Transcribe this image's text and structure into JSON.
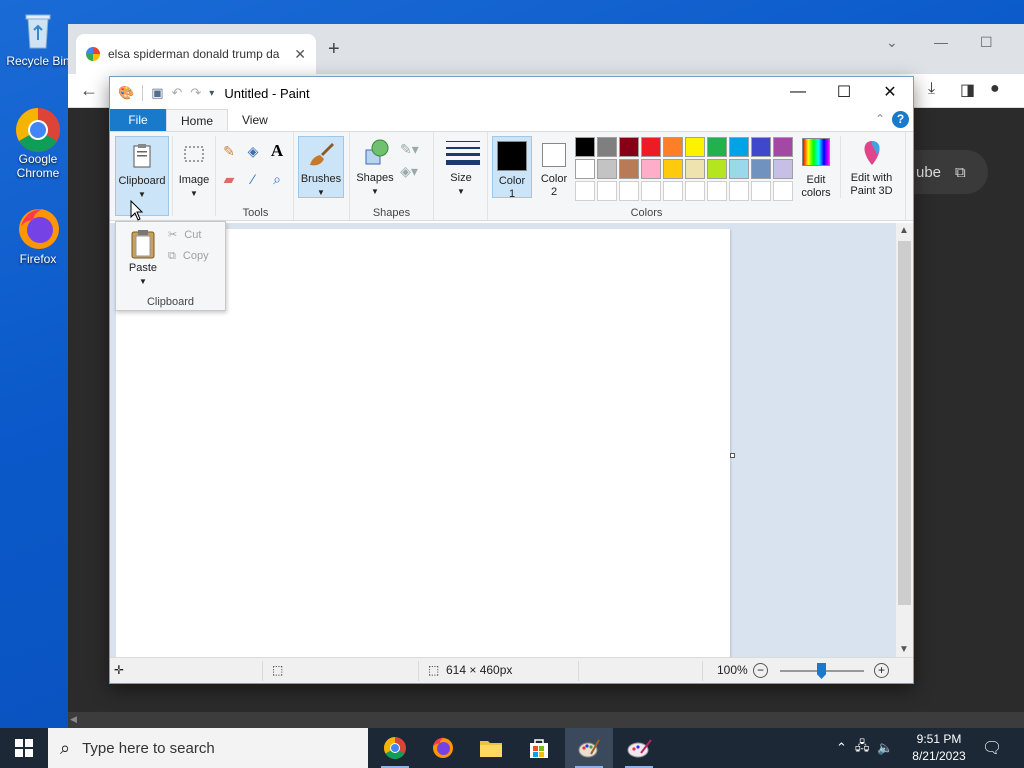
{
  "desktop": {
    "icons": [
      {
        "label": "Recycle Bin"
      },
      {
        "label": "Google Chrome"
      },
      {
        "label": "Firefox"
      }
    ]
  },
  "chrome": {
    "tab_title": "elsa spiderman donald trump da",
    "youtube_button_text": "ube"
  },
  "paint": {
    "title": "Untitled - Paint",
    "tabs": {
      "file": "File",
      "home": "Home",
      "view": "View"
    },
    "ribbon": {
      "clipboard": "Clipboard",
      "image": "Image",
      "tools_group": "Tools",
      "brushes": "Brushes",
      "shapes": "Shapes",
      "shapes_group": "Shapes",
      "size": "Size",
      "color1": "Color\n1",
      "color2": "Color\n2",
      "colors_group": "Colors",
      "edit_colors": "Edit\ncolors",
      "edit_paint3d": "Edit with\nPaint 3D"
    },
    "palette_colors": [
      "#000000",
      "#7f7f7f",
      "#880015",
      "#ed1c24",
      "#ff7f27",
      "#fff200",
      "#22b14c",
      "#00a2e8",
      "#3f48cc",
      "#a349a4",
      "#ffffff",
      "#c3c3c3",
      "#b97a57",
      "#ffaec9",
      "#ffc90e",
      "#efe4b0",
      "#b5e61d",
      "#99d9ea",
      "#7092be",
      "#c8bfe7",
      "#ffffff",
      "#ffffff",
      "#ffffff",
      "#ffffff",
      "#ffffff",
      "#ffffff",
      "#ffffff",
      "#ffffff",
      "#ffffff",
      "#ffffff"
    ],
    "color1_value": "#000000",
    "color2_value": "#ffffff",
    "clipboard_dropdown": {
      "paste": "Paste",
      "cut": "Cut",
      "copy": "Copy",
      "group": "Clipboard"
    },
    "status": {
      "image_size": "614 × 460px",
      "zoom": "100%"
    }
  },
  "taskbar": {
    "search_placeholder": "Type here to search",
    "time": "9:51 PM",
    "date": "8/21/2023"
  }
}
